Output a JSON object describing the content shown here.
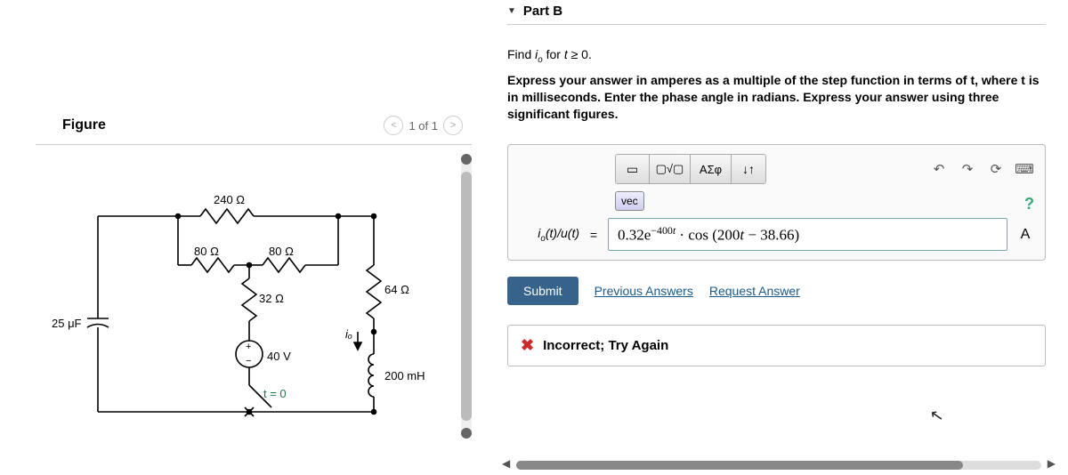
{
  "figure": {
    "title": "Figure",
    "pager_text": "1 of 1",
    "labels": {
      "r240": "240 Ω",
      "r80a": "80 Ω",
      "r80b": "80 Ω",
      "r32": "32 Ω",
      "r64": "64 Ω",
      "c25": "25 μF",
      "v40": "40 V",
      "l200": "200 mH",
      "t0": "t = 0",
      "io": "iₒ"
    }
  },
  "part": {
    "header": "Part B",
    "prompt_html": "Find iₒ for t ≥ 0.",
    "instructions": "Express your answer in amperes as a multiple of the step function in terms of t, where t is in milliseconds. Enter the phase angle in radians. Express your answer using three significant figures.",
    "toolbar": {
      "templates": "▢√▢",
      "greek": "ΑΣφ",
      "updown": "↓↑",
      "undo": "↶",
      "redo": "↷",
      "reset": "⟳",
      "keyboard": "⌨",
      "vec": "vec",
      "help": "?"
    },
    "answer": {
      "label": "iₒ(t)/u(t)",
      "equals": "=",
      "value": "0.32e⁻⁴⁰⁰ᵗ · cos (200t − 38.66)",
      "unit": "A"
    },
    "submit": "Submit",
    "previous": "Previous Answers",
    "request": "Request Answer",
    "feedback": "Incorrect; Try Again"
  }
}
